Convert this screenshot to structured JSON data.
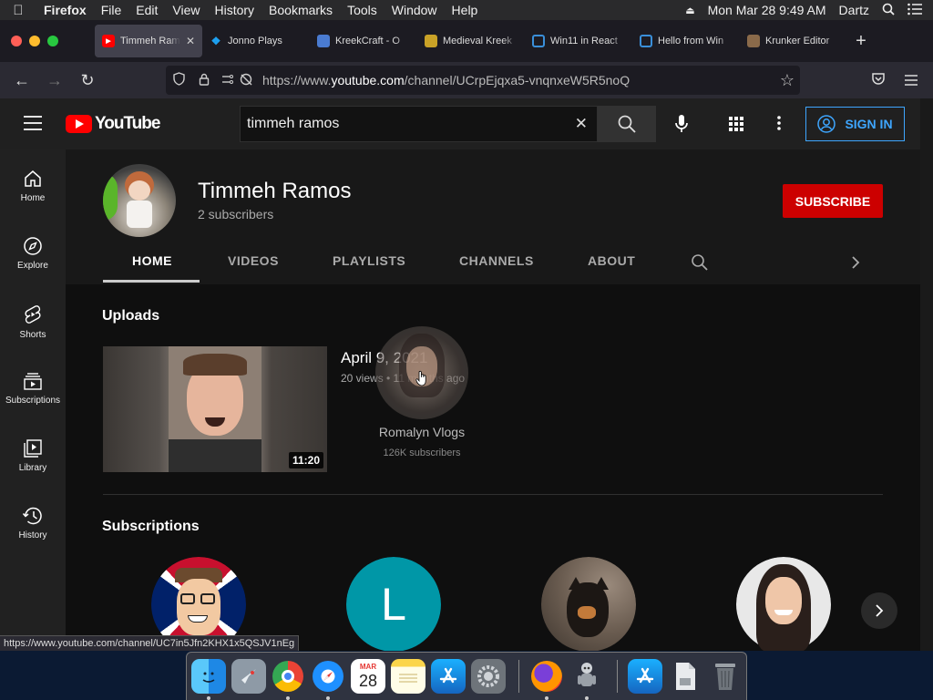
{
  "menubar": {
    "app": "Firefox",
    "items": [
      "File",
      "Edit",
      "View",
      "History",
      "Bookmarks",
      "Tools",
      "Window",
      "Help"
    ],
    "datetime": "Mon Mar 28  9:49 AM",
    "user": "Dartz"
  },
  "tabs": [
    {
      "title": "Timmeh Ramos - YouTube",
      "icon": "youtube-icon",
      "color": "#ff0000"
    },
    {
      "title": "Jonno Plays",
      "icon": "twitter-icon",
      "color": "#1da1f2"
    },
    {
      "title": "KreekCraft - O",
      "icon": "kreekcraft-icon",
      "color": "#4a7bd1"
    },
    {
      "title": "Medieval Kreek",
      "icon": "medieval-icon",
      "color": "#c9a227"
    },
    {
      "title": "Win11 in React",
      "icon": "win11-icon",
      "color": "#3a8fd9"
    },
    {
      "title": "Hello from Win",
      "icon": "win11-icon",
      "color": "#3a8fd9"
    },
    {
      "title": "Krunker Editor",
      "icon": "krunker-icon",
      "color": "#8a6a4a"
    }
  ],
  "url": {
    "prefix": "https://www.",
    "domain": "youtube.com",
    "path": "/channel/UCrpEjqxa5-vnqnxeW5R5noQ"
  },
  "youtube": {
    "logo_text": "YouTube",
    "search_value": "timmeh ramos",
    "sign_in": "SIGN IN"
  },
  "sidebar": [
    {
      "label": "Home",
      "icon": "home-icon"
    },
    {
      "label": "Explore",
      "icon": "compass-icon"
    },
    {
      "label": "Shorts",
      "icon": "shorts-icon"
    },
    {
      "label": "Subscriptions",
      "icon": "subscriptions-icon"
    },
    {
      "label": "Library",
      "icon": "library-icon"
    },
    {
      "label": "History",
      "icon": "history-icon"
    }
  ],
  "channel": {
    "name": "Timmeh Ramos",
    "subscribers": "2 subscribers",
    "subscribe": "SUBSCRIBE",
    "tabs": [
      "HOME",
      "VIDEOS",
      "PLAYLISTS",
      "CHANNELS",
      "ABOUT"
    ]
  },
  "uploads": {
    "heading": "Uploads",
    "video": {
      "title": "April 9, 2021",
      "meta": "20 views • 11 months ago",
      "duration": "11:20"
    }
  },
  "hover_card": {
    "name": "Romalyn Vlogs",
    "subscribers": "126K subscribers"
  },
  "subscriptions": {
    "heading": "Subscriptions",
    "letter_avatar": "L"
  },
  "status_url": "https://www.youtube.com/channel/UC7in5Jfn2KHX1x5QSJV1nEg",
  "dock_calendar": {
    "month": "MAR",
    "day": "28"
  }
}
